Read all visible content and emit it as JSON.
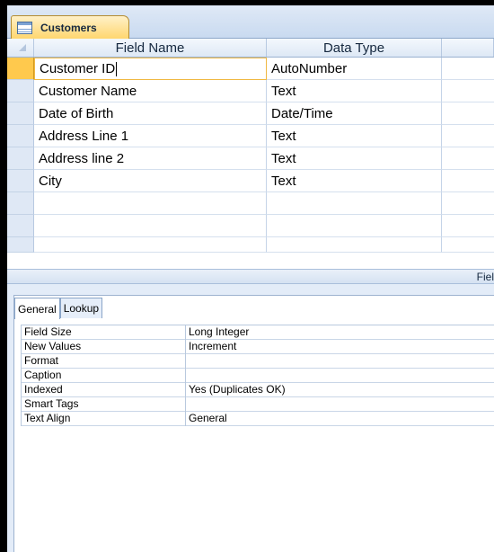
{
  "tab": {
    "title": "Customers",
    "icon": "table-icon"
  },
  "grid": {
    "headers": {
      "field_name": "Field Name",
      "data_type": "Data Type",
      "description": ""
    },
    "rows": [
      {
        "field_name": "Customer ID",
        "data_type": "AutoNumber"
      },
      {
        "field_name": "Customer Name",
        "data_type": "Text"
      },
      {
        "field_name": "Date of Birth",
        "data_type": "Date/Time"
      },
      {
        "field_name": "Address Line 1",
        "data_type": "Text"
      },
      {
        "field_name": "Address line 2",
        "data_type": "Text"
      },
      {
        "field_name": "City",
        "data_type": "Text"
      },
      {
        "field_name": "",
        "data_type": ""
      },
      {
        "field_name": "",
        "data_type": ""
      },
      {
        "field_name": "",
        "data_type": ""
      }
    ]
  },
  "properties_band": {
    "label": "Fiel"
  },
  "properties": {
    "tabs": [
      {
        "label": "General"
      },
      {
        "label": "Lookup"
      }
    ],
    "rows": [
      {
        "label": "Field Size",
        "value": "Long Integer"
      },
      {
        "label": "New Values",
        "value": "Increment"
      },
      {
        "label": "Format",
        "value": ""
      },
      {
        "label": "Caption",
        "value": ""
      },
      {
        "label": "Indexed",
        "value": "Yes (Duplicates OK)"
      },
      {
        "label": "Smart Tags",
        "value": ""
      },
      {
        "label": "Text Align",
        "value": "General"
      }
    ]
  },
  "colors": {
    "active_tab": "#ffd56b",
    "row_selector_active": "#ffc94d",
    "grid_line": "#c5d4e8"
  }
}
